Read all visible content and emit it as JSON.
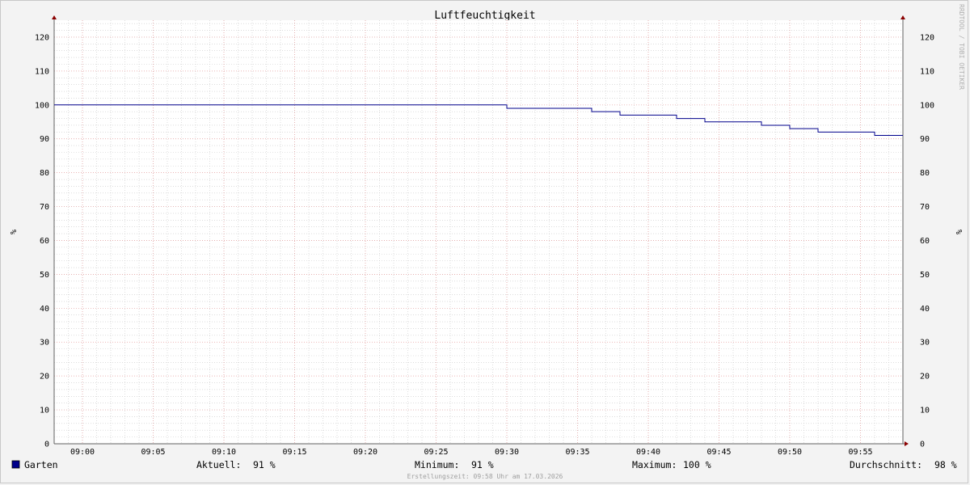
{
  "chart_data": {
    "type": "line",
    "title": "Luftfeuchtigkeit",
    "ylabel": "%",
    "ylabel_right": "%",
    "ylim": [
      0,
      125
    ],
    "y_ticks": [
      0,
      10,
      20,
      30,
      40,
      50,
      60,
      70,
      80,
      90,
      100,
      110,
      120
    ],
    "x_ticks": [
      "09:00",
      "09:05",
      "09:10",
      "09:15",
      "09:20",
      "09:25",
      "09:30",
      "09:35",
      "09:40",
      "09:45",
      "09:50",
      "09:55"
    ],
    "xlim": [
      "08:58",
      "09:58"
    ],
    "grid": true,
    "series": [
      {
        "name": "Garten",
        "color": "#00008b",
        "points": [
          {
            "t": "08:58",
            "v": 100
          },
          {
            "t": "09:30",
            "v": 99
          },
          {
            "t": "09:36",
            "v": 98
          },
          {
            "t": "09:38",
            "v": 97
          },
          {
            "t": "09:42",
            "v": 96
          },
          {
            "t": "09:44",
            "v": 95
          },
          {
            "t": "09:48",
            "v": 94
          },
          {
            "t": "09:50",
            "v": 93
          },
          {
            "t": "09:52",
            "v": 92
          },
          {
            "t": "09:54",
            "v": 92
          },
          {
            "t": "09:56",
            "v": 91
          },
          {
            "t": "09:58",
            "v": 91
          }
        ]
      }
    ]
  },
  "legend": {
    "series_name": "Garten",
    "series_color": "#00008b",
    "current_label": "Aktuell:",
    "current_value": "91 %",
    "min_label": "Minimum:",
    "min_value": "91 %",
    "max_label": "Maximum:",
    "max_value": "100 %",
    "avg_label": "Durchschnitt:",
    "avg_value": "98 %"
  },
  "footer": "Erstellungszeit: 09:58 Uhr am 17.03.2026",
  "watermark": "RRDTOOL / TOBI OETIKER",
  "colors": {
    "background": "#f3f3f3",
    "plot_background": "#ffffff",
    "major_grid": "#e8a0a0",
    "minor_grid": "#c8c8c8",
    "axis": "#606060",
    "arrow": "#8b0000"
  }
}
